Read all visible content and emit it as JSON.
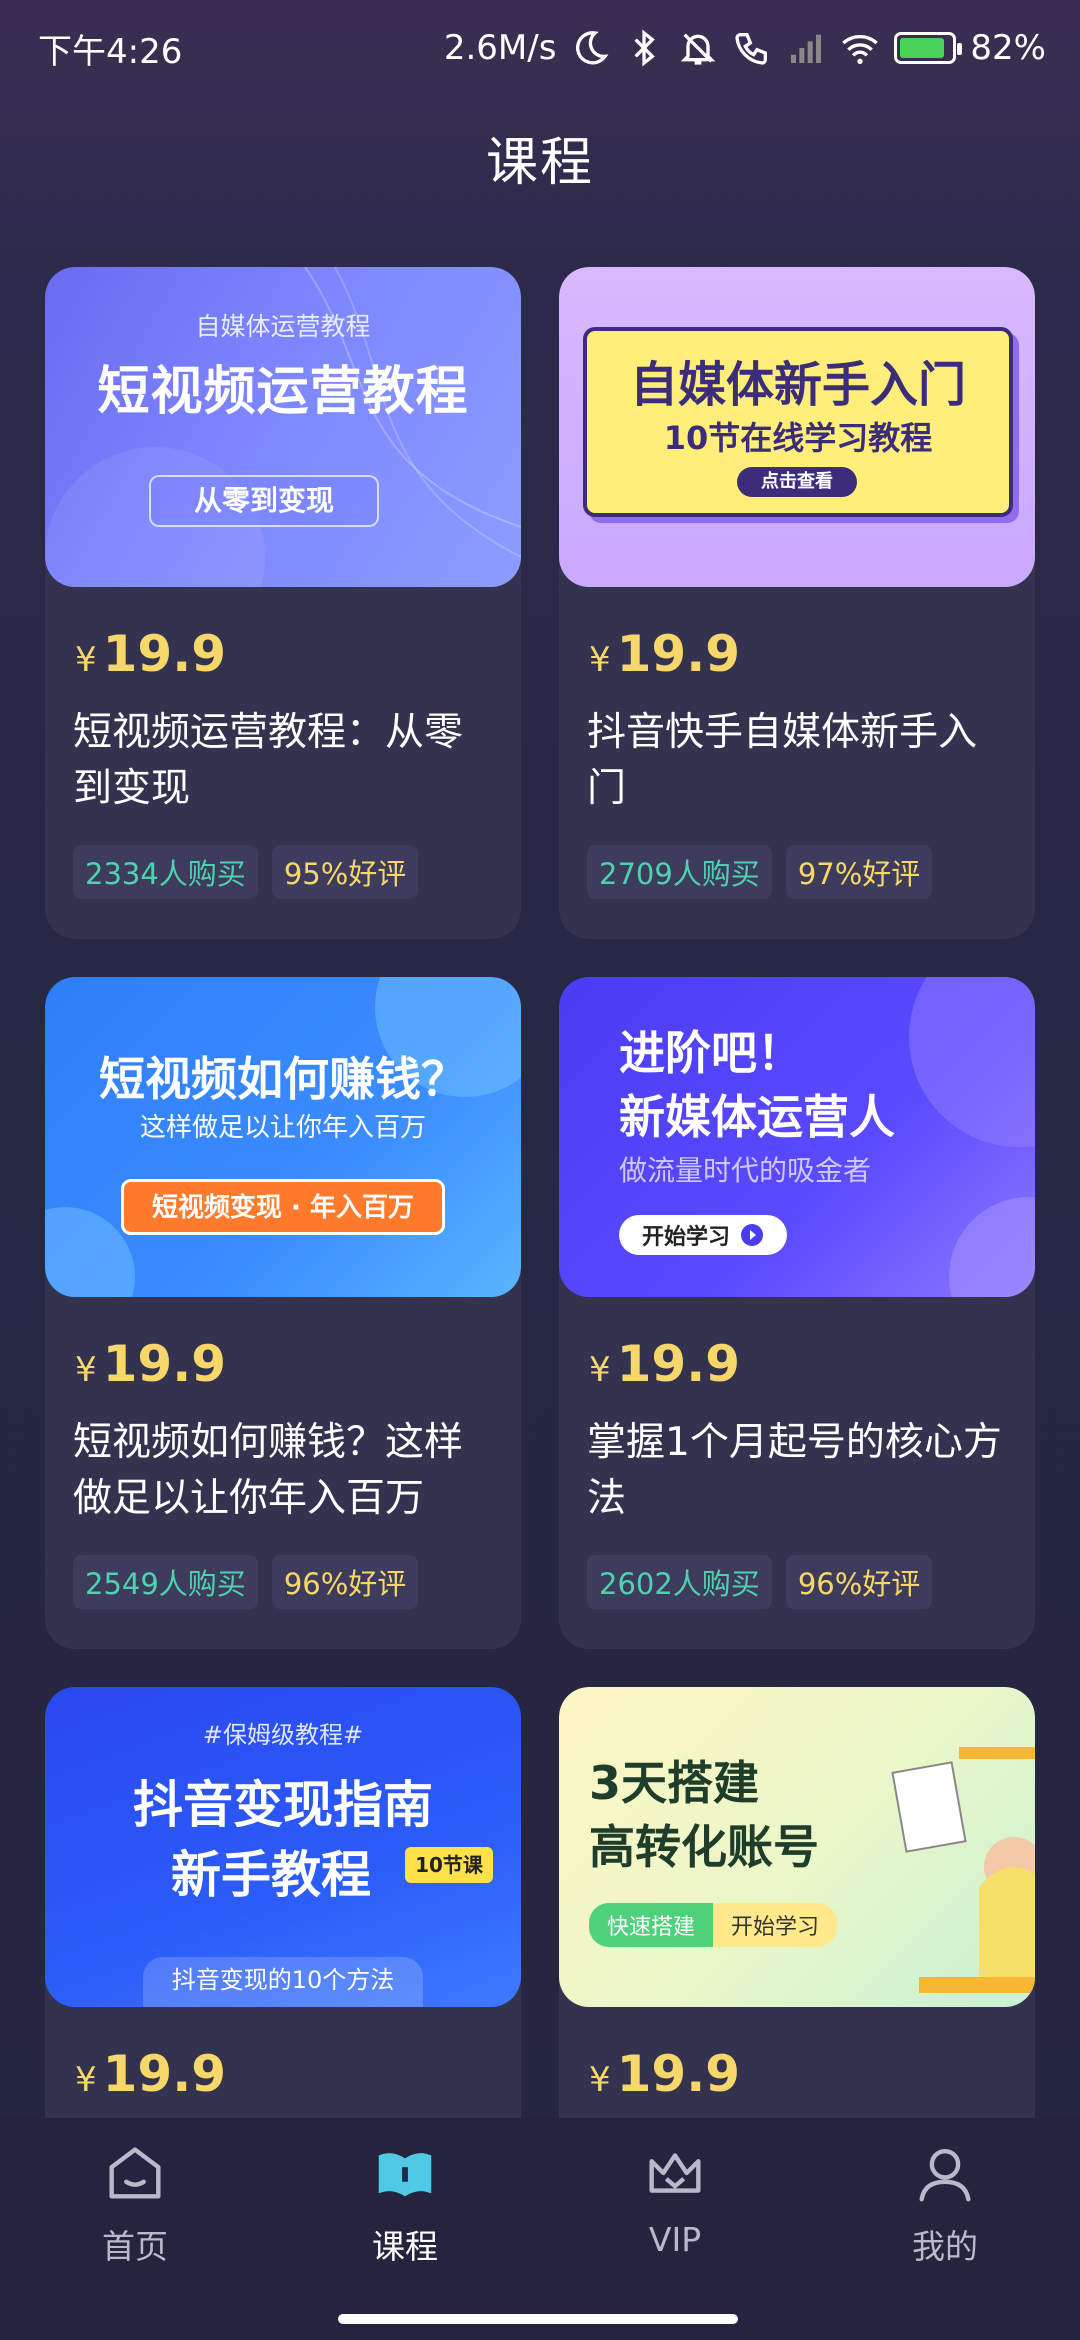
{
  "status_bar": {
    "time": "下午4:26",
    "speed": "2.6M/s",
    "battery": "82%"
  },
  "header": {
    "title": "课程"
  },
  "courses": [
    {
      "cover_subtitle": "自媒体运营教程",
      "cover_title": "短视频运营教程",
      "cover_tag": "从零到变现",
      "currency": "¥",
      "price": "19.9",
      "title": "短视频运营教程：从零到变现",
      "buyers": "2334人购买",
      "rating": "95%好评"
    },
    {
      "cover_title": "自媒体新手入门",
      "cover_subtitle": "10节在线学习教程",
      "cover_tag": "点击查看",
      "currency": "¥",
      "price": "19.9",
      "title": "抖音快手自媒体新手入门",
      "buyers": "2709人购买",
      "rating": "97%好评"
    },
    {
      "cover_title": "短视频如何赚钱？",
      "cover_subtitle": "这样做足以让你年入百万",
      "cover_tag": "短视频变现 · 年入百万",
      "currency": "¥",
      "price": "19.9",
      "title": "短视频如何赚钱？这样做足以让你年入百万",
      "buyers": "2549人购买",
      "rating": "96%好评"
    },
    {
      "cover_title_line1": "进阶吧！",
      "cover_title_line2": "新媒体运营人",
      "cover_subtitle": "做流量时代的吸金者",
      "cover_tag": "开始学习",
      "currency": "¥",
      "price": "19.9",
      "title": "掌握1个月起号的核心方法",
      "buyers": "2602人购买",
      "rating": "96%好评"
    },
    {
      "cover_top": "#保姆级教程#",
      "cover_title_line1": "抖音变现指南",
      "cover_title_line2": "新手教程",
      "cover_badge": "10节课",
      "cover_bottom": "抖音变现的10个方法",
      "currency": "¥",
      "price": "19.9"
    },
    {
      "cover_title_line1": "3天搭建",
      "cover_title_line2": "高转化账号",
      "cover_tag1": "快速搭建",
      "cover_tag2": "开始学习",
      "currency": "¥",
      "price": "19.9"
    }
  ],
  "bottom_nav": {
    "items": [
      {
        "label": "首页",
        "icon": "home-icon"
      },
      {
        "label": "课程",
        "icon": "course-icon"
      },
      {
        "label": "VIP",
        "icon": "vip-crown-icon"
      },
      {
        "label": "我的",
        "icon": "profile-icon"
      }
    ],
    "active": "课程"
  }
}
